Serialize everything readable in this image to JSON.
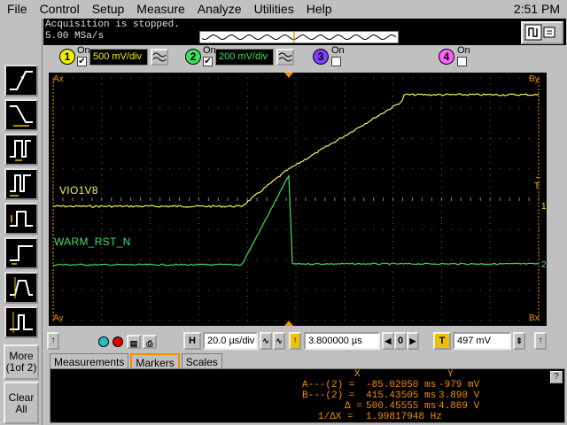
{
  "menubar": {
    "items": [
      "File",
      "Control",
      "Setup",
      "Measure",
      "Analyze",
      "Utilities",
      "Help"
    ],
    "clock": "2:51 PM"
  },
  "status": {
    "line1": "Acquisition is stopped.",
    "line2": "5.00 MSa/s"
  },
  "channels": [
    {
      "number": "1",
      "on_label": "On",
      "scale": "500 mV/div",
      "checked": true,
      "color": "#f0f000"
    },
    {
      "number": "2",
      "on_label": "On",
      "scale": "200 mV/div",
      "checked": true,
      "color": "#40e060"
    },
    {
      "number": "3",
      "on_label": "On",
      "checked": false,
      "color": "#8040ff"
    },
    {
      "number": "4",
      "on_label": "On",
      "checked": false,
      "color": "#ff60ff"
    }
  ],
  "display": {
    "corner_ax": "Ax",
    "corner_ay": "Ay",
    "corner_by": "By",
    "corner_bx": "Bx",
    "trace1_label": "VIO1V8",
    "trace2_label": "WARM_RST_N",
    "trigger_marker": "← T",
    "gnd1_marker": "1",
    "gnd2_marker": "2",
    "trace1_color": "#f0f060",
    "trace2_color": "#40e060"
  },
  "left_toolbar": {
    "more_label": "More",
    "more_page": "(1of 2)",
    "clear_label": "Clear",
    "clear_sub": "All"
  },
  "horizontal": {
    "h_label": "H",
    "timebase": "20.0 µs/div",
    "delay": "3.800000 µs",
    "t_label": "T",
    "trigger_level": "497 mV",
    "zero_label": "0"
  },
  "tabs": [
    "Measurements",
    "Markers",
    "Scales"
  ],
  "markers": {
    "header_x": "X",
    "header_y": "Y",
    "rows": [
      {
        "label": "A---(2) =",
        "x": "-85.02050 ms",
        "y": "-979 mV"
      },
      {
        "label": "B---(2) =",
        "x": "415.43505 ms",
        "y": "3.890 V"
      },
      {
        "label": "Δ =",
        "x": "500.45555 ms",
        "y": "4.869 V"
      },
      {
        "label": "1/ΔX =",
        "x": "1.99817948 Hz",
        "y": ""
      }
    ],
    "help_label": "?"
  }
}
